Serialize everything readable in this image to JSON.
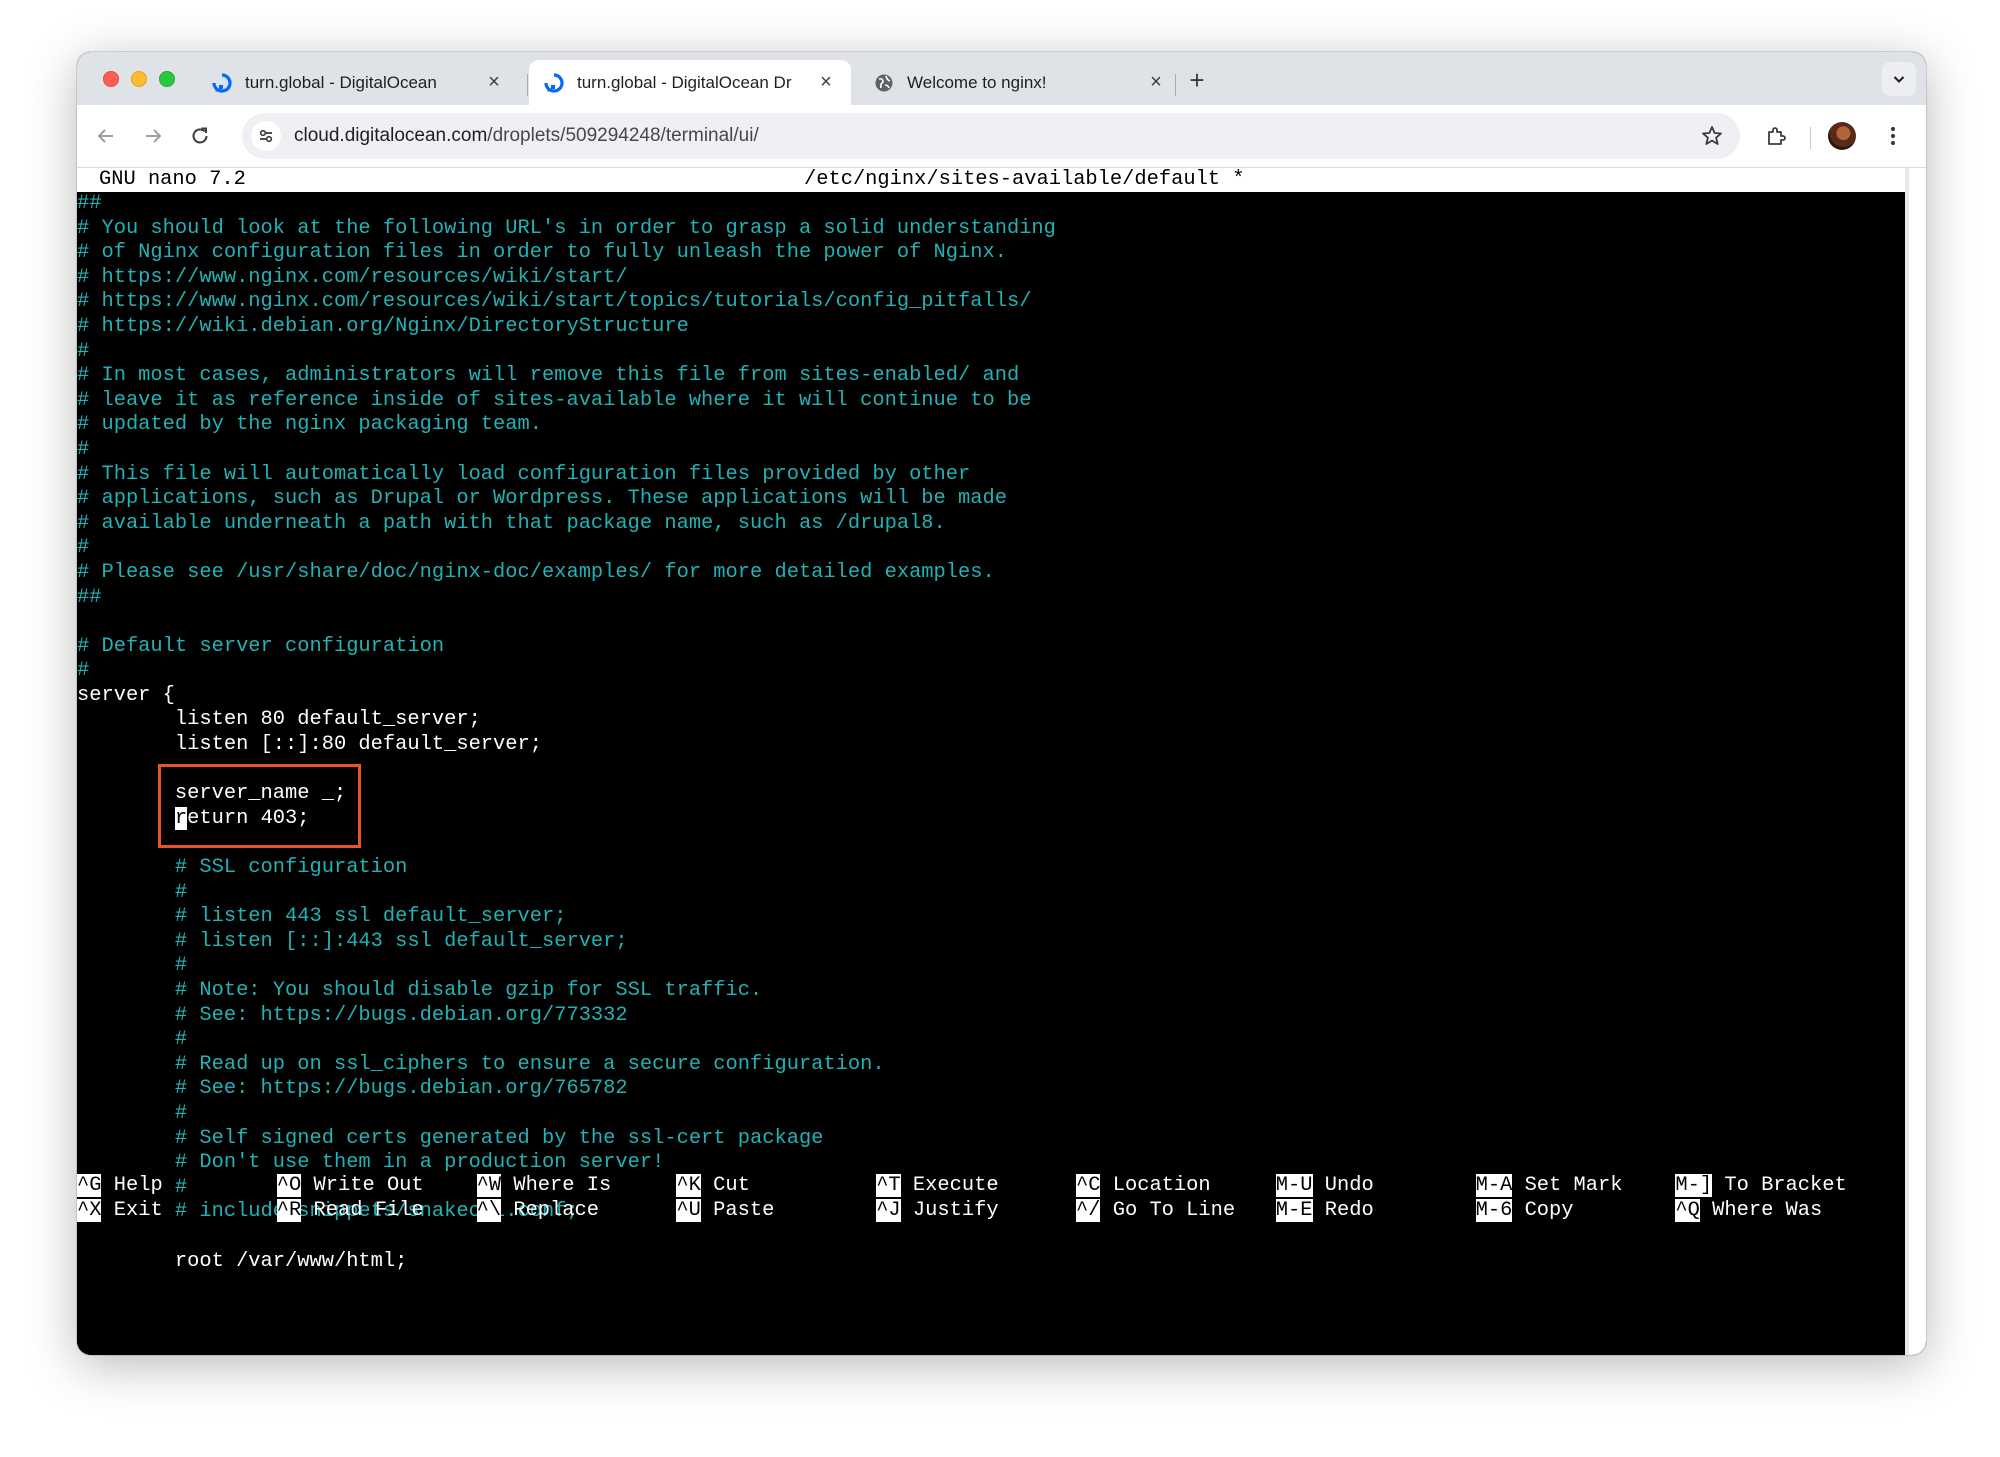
{
  "browser": {
    "tabs": [
      {
        "title": "turn.global - DigitalOcean",
        "favicon": "digitalocean-icon",
        "active": false
      },
      {
        "title": "turn.global - DigitalOcean Dr",
        "favicon": "digitalocean-icon",
        "active": true
      },
      {
        "title": "Welcome to nginx!",
        "favicon": "globe-icon",
        "active": false
      }
    ],
    "close_glyph": "×",
    "new_tab_glyph": "+",
    "url_host": "cloud.digitalocean.com",
    "url_path": "/droplets/509294248/terminal/ui/"
  },
  "nano": {
    "app": "GNU nano 7.2",
    "file": "/etc/nginx/sites-available/default *"
  },
  "lines": [
    {
      "text": "##",
      "kind": "comment"
    },
    {
      "text": "# You should look at the following URL's in order to grasp a solid understanding",
      "kind": "comment"
    },
    {
      "text": "# of Nginx configuration files in order to fully unleash the power of Nginx.",
      "kind": "comment"
    },
    {
      "text": "# https://www.nginx.com/resources/wiki/start/",
      "kind": "comment"
    },
    {
      "text": "# https://www.nginx.com/resources/wiki/start/topics/tutorials/config_pitfalls/",
      "kind": "comment"
    },
    {
      "text": "# https://wiki.debian.org/Nginx/DirectoryStructure",
      "kind": "comment"
    },
    {
      "text": "#",
      "kind": "comment"
    },
    {
      "text": "# In most cases, administrators will remove this file from sites-enabled/ and",
      "kind": "comment"
    },
    {
      "text": "# leave it as reference inside of sites-available where it will continue to be",
      "kind": "comment"
    },
    {
      "text": "# updated by the nginx packaging team.",
      "kind": "comment"
    },
    {
      "text": "#",
      "kind": "comment"
    },
    {
      "text": "# This file will automatically load configuration files provided by other",
      "kind": "comment"
    },
    {
      "text": "# applications, such as Drupal or Wordpress. These applications will be made",
      "kind": "comment"
    },
    {
      "text": "# available underneath a path with that package name, such as /drupal8.",
      "kind": "comment"
    },
    {
      "text": "#",
      "kind": "comment"
    },
    {
      "text": "# Please see /usr/share/doc/nginx-doc/examples/ for more detailed examples.",
      "kind": "comment"
    },
    {
      "text": "##",
      "kind": "comment"
    },
    {
      "text": "",
      "kind": "code"
    },
    {
      "text": "# Default server configuration",
      "kind": "comment"
    },
    {
      "text": "#",
      "kind": "comment"
    },
    {
      "text": "server {",
      "kind": "code"
    },
    {
      "text": "        listen 80 default_server;",
      "kind": "code"
    },
    {
      "text": "        listen [::]:80 default_server;",
      "kind": "code"
    },
    {
      "text": "",
      "kind": "code"
    },
    {
      "text": "        server_name _;",
      "kind": "code"
    },
    {
      "text": "        return 403;",
      "kind": "code",
      "cursor_col": 8
    },
    {
      "text": "",
      "kind": "code"
    },
    {
      "text": "        # SSL configuration",
      "kind": "comment"
    },
    {
      "text": "        #",
      "kind": "comment"
    },
    {
      "text": "        # listen 443 ssl default_server;",
      "kind": "comment"
    },
    {
      "text": "        # listen [::]:443 ssl default_server;",
      "kind": "comment"
    },
    {
      "text": "        #",
      "kind": "comment"
    },
    {
      "text": "        # Note: You should disable gzip for SSL traffic.",
      "kind": "comment"
    },
    {
      "text": "        # See: https://bugs.debian.org/773332",
      "kind": "comment"
    },
    {
      "text": "        #",
      "kind": "comment"
    },
    {
      "text": "        # Read up on ssl_ciphers to ensure a secure configuration.",
      "kind": "comment"
    },
    {
      "text": "        # See: https://bugs.debian.org/765782",
      "kind": "comment"
    },
    {
      "text": "        #",
      "kind": "comment"
    },
    {
      "text": "        # Self signed certs generated by the ssl-cert package",
      "kind": "comment"
    },
    {
      "text": "        # Don't use them in a production server!",
      "kind": "comment"
    },
    {
      "text": "        #",
      "kind": "comment"
    },
    {
      "text": "        # include snippets/snakeoil.conf;",
      "kind": "comment"
    },
    {
      "text": "",
      "kind": "code"
    },
    {
      "text": "        root /var/www/html;",
      "kind": "code"
    }
  ],
  "shortcuts": [
    {
      "key": "^G",
      "label": "Help"
    },
    {
      "key": "^X",
      "label": "Exit"
    },
    {
      "key": "^O",
      "label": "Write Out"
    },
    {
      "key": "^R",
      "label": "Read File"
    },
    {
      "key": "^W",
      "label": "Where Is"
    },
    {
      "key": "^\\",
      "label": "Replace"
    },
    {
      "key": "^K",
      "label": "Cut"
    },
    {
      "key": "^U",
      "label": "Paste"
    },
    {
      "key": "^T",
      "label": "Execute"
    },
    {
      "key": "^J",
      "label": "Justify"
    },
    {
      "key": "^C",
      "label": "Location"
    },
    {
      "key": "^/",
      "label": "Go To Line"
    },
    {
      "key": "M-U",
      "label": "Undo"
    },
    {
      "key": "M-E",
      "label": "Redo"
    },
    {
      "key": "M-A",
      "label": "Set Mark"
    },
    {
      "key": "M-6",
      "label": "Copy"
    },
    {
      "key": "M-]",
      "label": "To Bracket"
    },
    {
      "key": "^Q",
      "label": "Where Was"
    }
  ],
  "colors": {
    "comment": "#22b2b4",
    "highlight_box": "#e6542a",
    "terminal_bg": "#000000"
  }
}
